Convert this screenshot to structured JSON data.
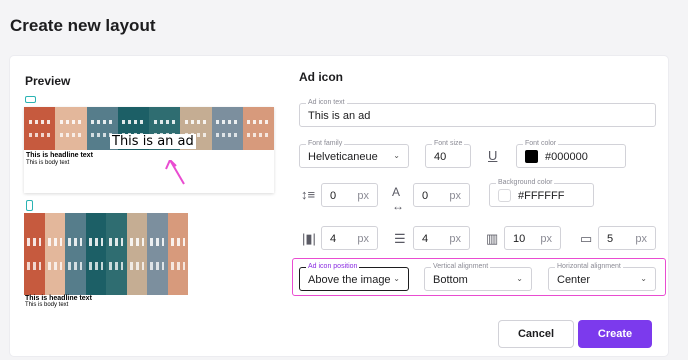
{
  "page": {
    "title": "Create new layout"
  },
  "preview": {
    "title": "Preview",
    "ad_icon_text": "This is an ad",
    "headline": "This is headline text",
    "body": "This is body text",
    "house_colors": [
      "#c65a3e",
      "#e3b79b",
      "#567d8b",
      "#1c5f66",
      "#2f6d71",
      "#c5ad93",
      "#7c8f9e",
      "#d79a7c"
    ]
  },
  "settings": {
    "title": "Ad icon",
    "ad_icon_text": {
      "label": "Ad icon text",
      "value": "This is an ad"
    },
    "font_family": {
      "label": "Font family",
      "value": "Helveticaneue"
    },
    "font_size": {
      "label": "Font size",
      "value": "40"
    },
    "underline_icon": "underline-icon",
    "font_color": {
      "label": "Font color",
      "value": "#000000",
      "swatch": "#000000"
    },
    "line_height": {
      "value": "0",
      "unit": "px"
    },
    "letter_spacing": {
      "value": "0",
      "unit": "px"
    },
    "background_color": {
      "label": "Background color",
      "value": "#FFFFFF",
      "swatch": "#FFFFFF"
    },
    "padding_horizontal": {
      "value": "4",
      "unit": "px"
    },
    "padding_vertical": {
      "value": "4",
      "unit": "px"
    },
    "margin": {
      "value": "10",
      "unit": "px"
    },
    "border_radius": {
      "value": "5",
      "unit": "px"
    },
    "ad_icon_position": {
      "label": "Ad icon position",
      "value": "Above the image"
    },
    "vertical_alignment": {
      "label": "Vertical alignment",
      "value": "Bottom"
    },
    "horizontal_alignment": {
      "label": "Horizontal alignment",
      "value": "Center"
    }
  },
  "actions": {
    "cancel": "Cancel",
    "create": "Create"
  },
  "colors": {
    "accent": "#7c3aed",
    "highlight": "#e94cd1",
    "device_icon": "#2bb3b3"
  }
}
